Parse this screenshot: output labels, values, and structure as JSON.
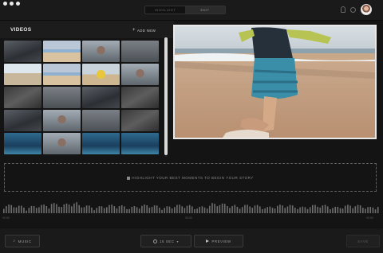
{
  "window": {
    "traffic_lights": [
      "close",
      "minimize",
      "zoom"
    ]
  },
  "mode_toggle": {
    "tabs": [
      {
        "label": "HIGHLIGHT",
        "active": false
      },
      {
        "label": "EDIT",
        "active": true
      }
    ]
  },
  "topbar_icons": [
    "bell-icon",
    "circle-icon",
    "avatar"
  ],
  "library": {
    "title": "VIDEOS",
    "add_new_label": "ADD NEW",
    "thumbnails": [
      "dark",
      "beach",
      "people",
      "grey",
      "bright",
      "beach",
      "yellow",
      "people",
      "rock",
      "grey",
      "dark",
      "rock",
      "dark",
      "people",
      "grey",
      "rock",
      "sea",
      "people",
      "sea",
      "sea"
    ]
  },
  "drop_zone": {
    "message": "HIGHLIGHT YOUR BEST MOMENTS TO BEGIN YOUR STORY"
  },
  "waveform": {
    "time_labels": [
      "00:00",
      "00:00",
      "00:00"
    ]
  },
  "bottom_bar": {
    "music_label": "MUSIC",
    "duration_label": "15 SEC",
    "preview_label": "PREVIEW",
    "save_label": "SAVE"
  },
  "colors": {
    "background": "#141414",
    "frame_border": "#e8e8e8",
    "scroll_thumb": "#d8d8d8"
  }
}
